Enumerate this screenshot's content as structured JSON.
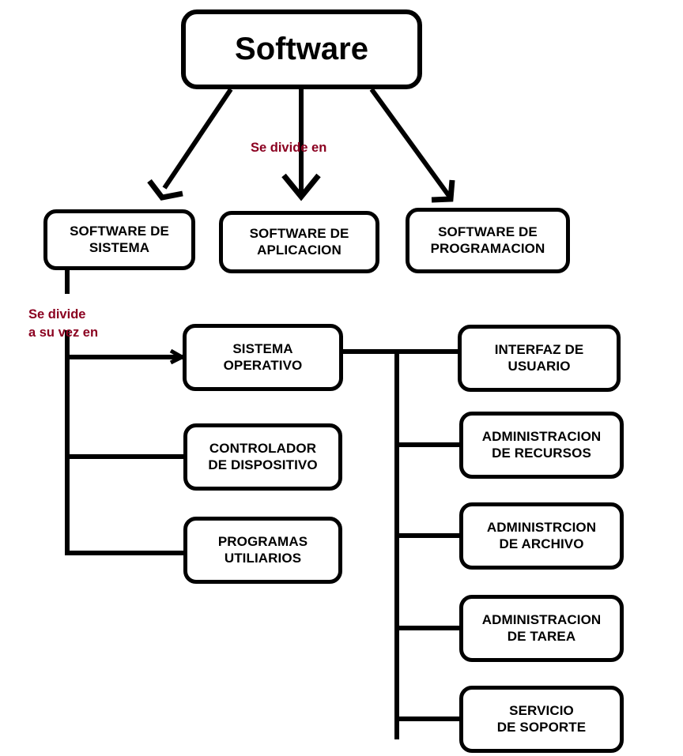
{
  "diagram": {
    "title": "Software",
    "root": {
      "label": "Software"
    },
    "edge_labels": [
      {
        "id": "se-divide-en",
        "text": "Se divide en"
      },
      {
        "id": "se-divide-a-su-vez-en",
        "text": "Se divide\na su vez en"
      }
    ],
    "level2": [
      {
        "id": "software-de-sistema",
        "label": "SOFTWARE DE\nSISTEMA"
      },
      {
        "id": "software-de-aplicacion",
        "label": "SOFTWARE DE\nAPLICACION"
      },
      {
        "id": "software-de-programacion",
        "label": "SOFTWARE DE\nPROGRAMACION"
      }
    ],
    "level3": [
      {
        "id": "sistema-operativo",
        "label": "SISTEMA\nOPERATIVO"
      },
      {
        "id": "controlador-de-dispositivo",
        "label": "CONTROLADOR\nDE DISPOSITIVO"
      },
      {
        "id": "programas-utiliarios",
        "label": "PROGRAMAS\nUTILIARIOS"
      }
    ],
    "level4": [
      {
        "id": "interfaz-de-usuario",
        "label": "INTERFAZ DE\nUSUARIO"
      },
      {
        "id": "administracion-de-recursos",
        "label": "ADMINISTRACION\nDE RECURSOS"
      },
      {
        "id": "administrcion-de-archivo",
        "label": "ADMINISTRCION\nDE ARCHIVO"
      },
      {
        "id": "administracion-de-tarea",
        "label": "ADMINISTRACION\nDE TAREA"
      },
      {
        "id": "servicio-de-soporte",
        "label": "SERVICIO\nDE SOPORTE"
      }
    ],
    "colors": {
      "stroke": "#000000",
      "box_fill": "#ffffff",
      "text": "#000000",
      "edge_label": "#8B0020",
      "background": "#ffffff"
    }
  }
}
